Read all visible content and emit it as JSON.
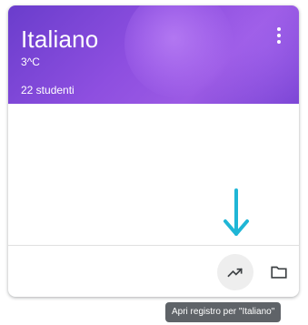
{
  "card": {
    "title": "Italiano",
    "section": "3^C",
    "students": "22 studenti",
    "header_color": "#8e4fe0",
    "more_icon": "more-vert-icon"
  },
  "actions": {
    "trends_icon": "trending-up-icon",
    "folder_icon": "folder-icon"
  },
  "annotation": {
    "arrow_color": "#1fb6d6"
  },
  "tooltip": {
    "text": "Apri registro per \"Italiano\""
  }
}
